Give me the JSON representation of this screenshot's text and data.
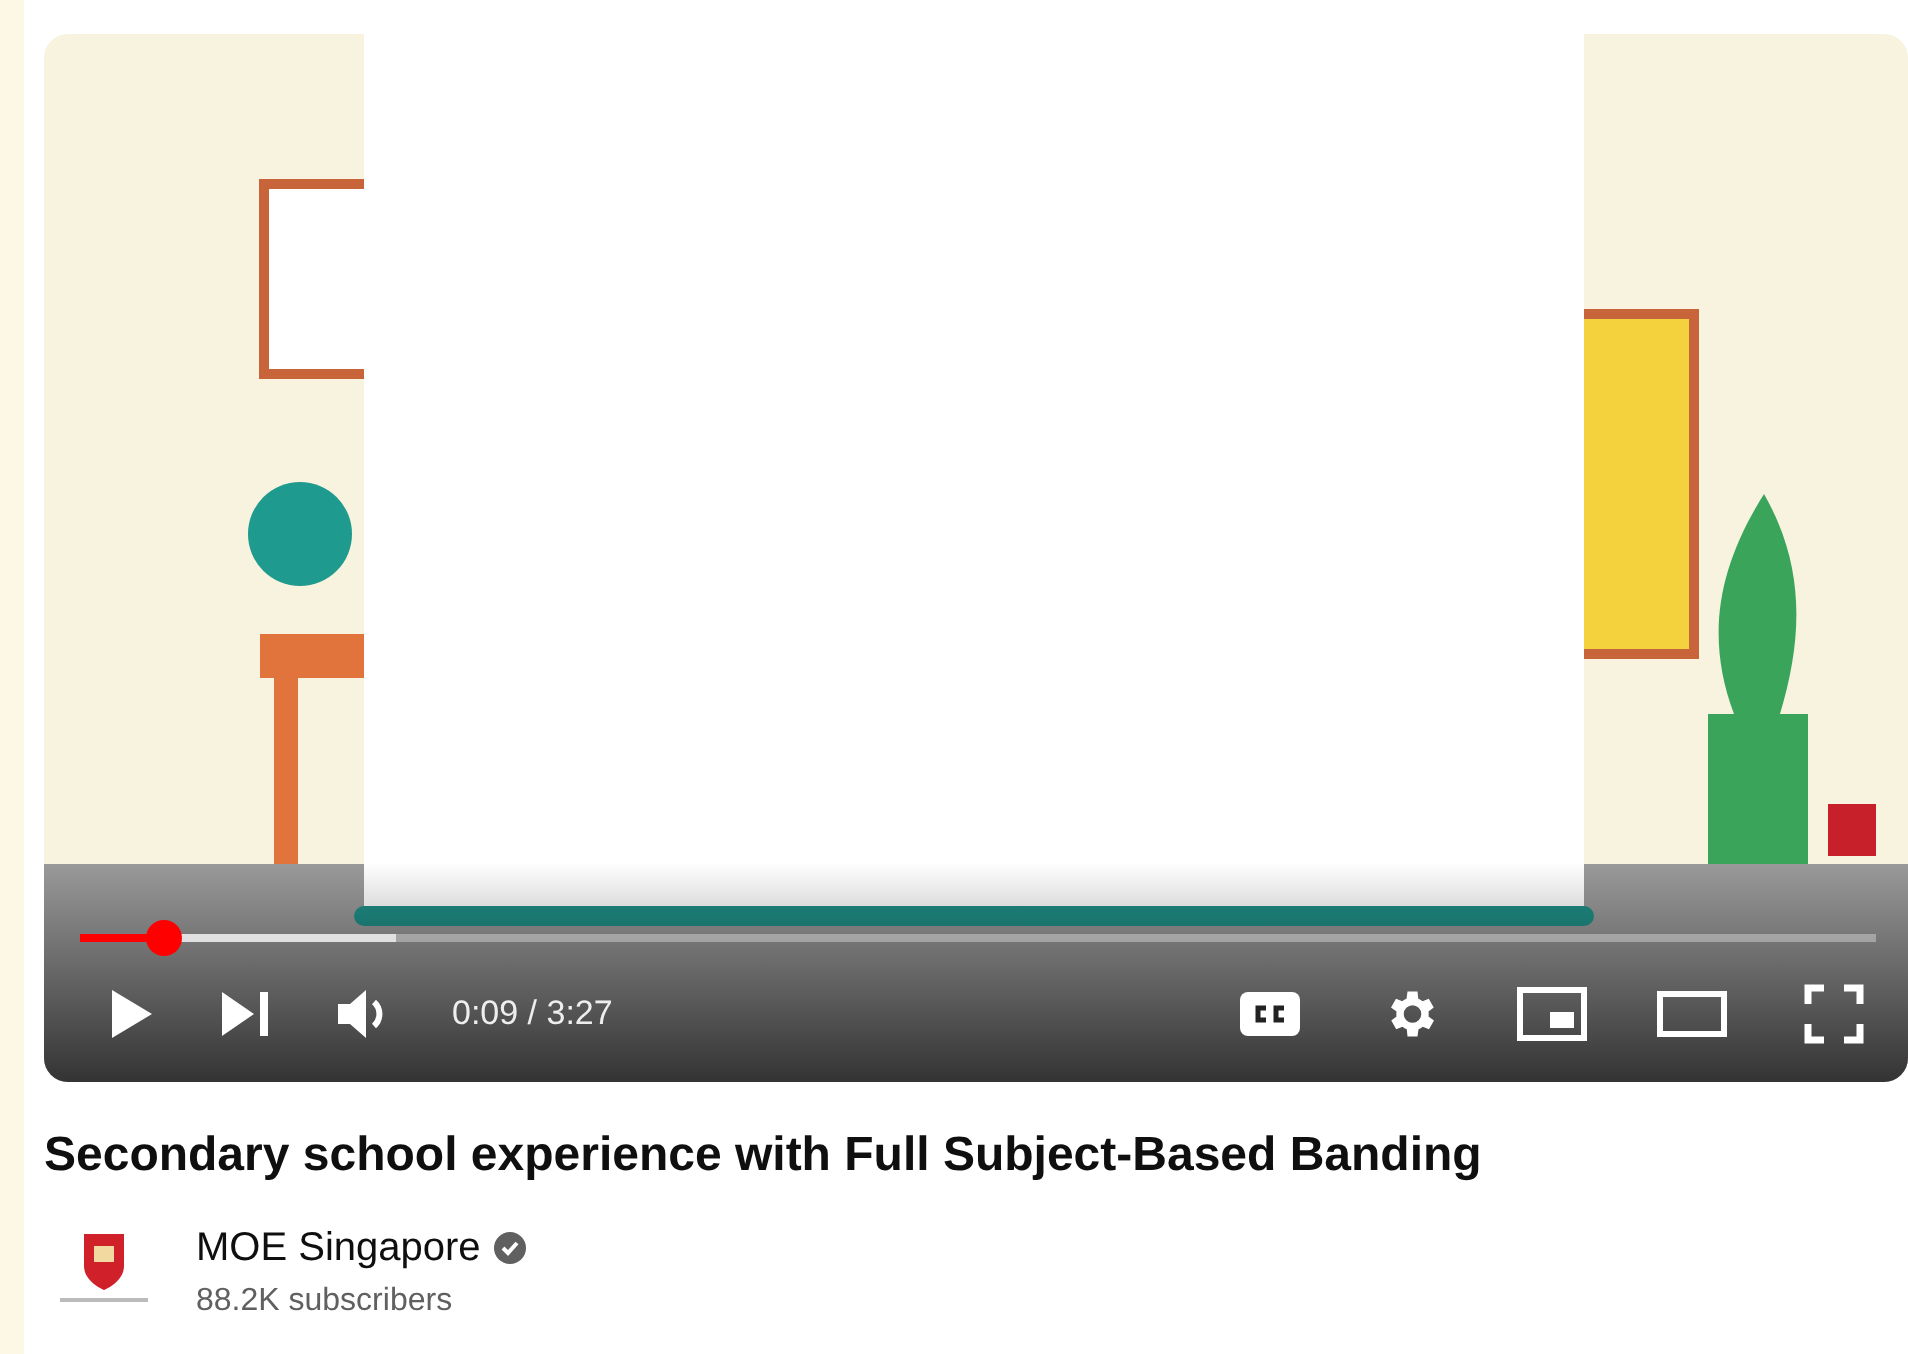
{
  "player": {
    "progress": {
      "level": 0.047
    },
    "buffer": {
      "level": 0.176
    },
    "time": "0:09 / 3:27",
    "captions_on": true
  },
  "video": {
    "title": "Secondary school experience with Full Subject-Based Banding"
  },
  "channel": {
    "name": "MOE Singapore",
    "verified": true,
    "subscribers": "88.2K subscribers"
  }
}
